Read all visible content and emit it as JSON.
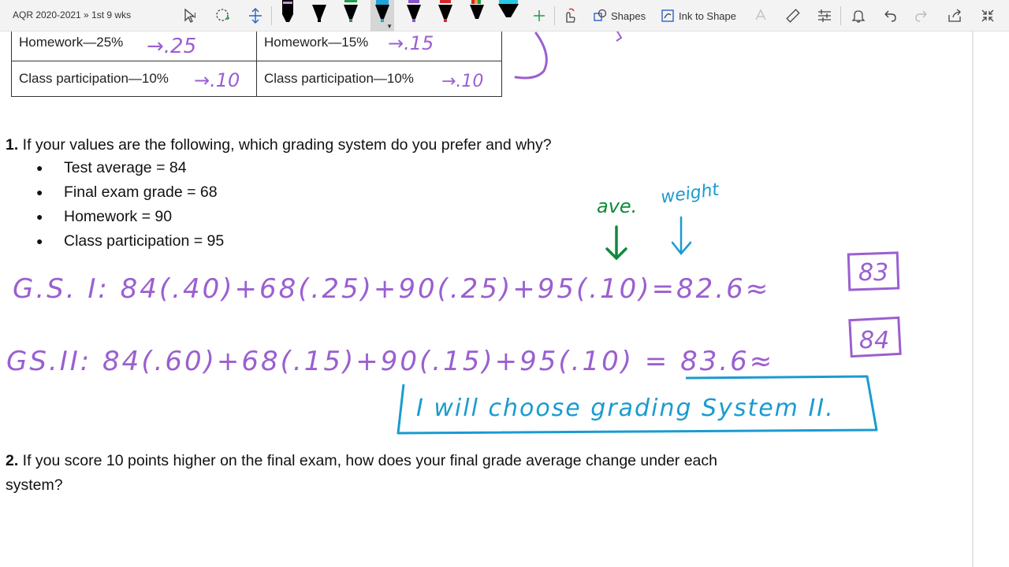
{
  "header": {
    "breadcrumb": "AQR 2020-2021 » 1st 9 wks"
  },
  "toolbar": {
    "shapes_label": "Shapes",
    "ink_to_shape_label": "Ink to Shape",
    "pens": [
      {
        "color": "#000000",
        "tip": "#c896d8"
      },
      {
        "color": "#000000",
        "tip": "#000000"
      },
      {
        "color": "#000000",
        "tip": "#1e9e4a"
      },
      {
        "color": "#000000",
        "tip": "#1fa3d8",
        "selected": true
      },
      {
        "color": "#000000",
        "tip": "#8a55c9"
      },
      {
        "color": "#000000",
        "tip": "#d62828"
      },
      {
        "color": "#000000",
        "tip": "#f2a33a"
      },
      {
        "color": "#000000",
        "tip": "#27c8e6"
      }
    ]
  },
  "table": {
    "rows": [
      [
        "Homework—25%",
        "Homework—15%"
      ],
      [
        "Class participation—10%",
        "Class participation—10%"
      ]
    ]
  },
  "question1": {
    "number": "1.",
    "text": " If your values are the following, which grading system do you prefer and why?",
    "bullets": [
      "Test average = 84",
      "Final exam grade = 68",
      "Homework = 90",
      "Class participation = 95"
    ]
  },
  "question2": {
    "number": "2.",
    "text": " If you score 10 points higher on the final exam, how does your final grade average change under each",
    "text_line2": "system?"
  },
  "ink": {
    "table_annotations": [
      "→.25",
      "→.15",
      "→.10",
      "→.10"
    ],
    "label_ave": "ave.",
    "label_weight": "weight",
    "gs1": "G.S. I:  84(.40)+68(.25)+90(.25)+95(.10)=82.6≈",
    "gs1_result": "83",
    "gs2": "GS.II:  84(.60)+68(.15)+90(.15)+95(.10) = 83.6≈",
    "gs2_result": "84",
    "conclusion": "I will choose grading System II.",
    "colors": {
      "purple": "#9b5fd0",
      "green": "#0f8a3c",
      "blue": "#1a9bd0"
    }
  }
}
